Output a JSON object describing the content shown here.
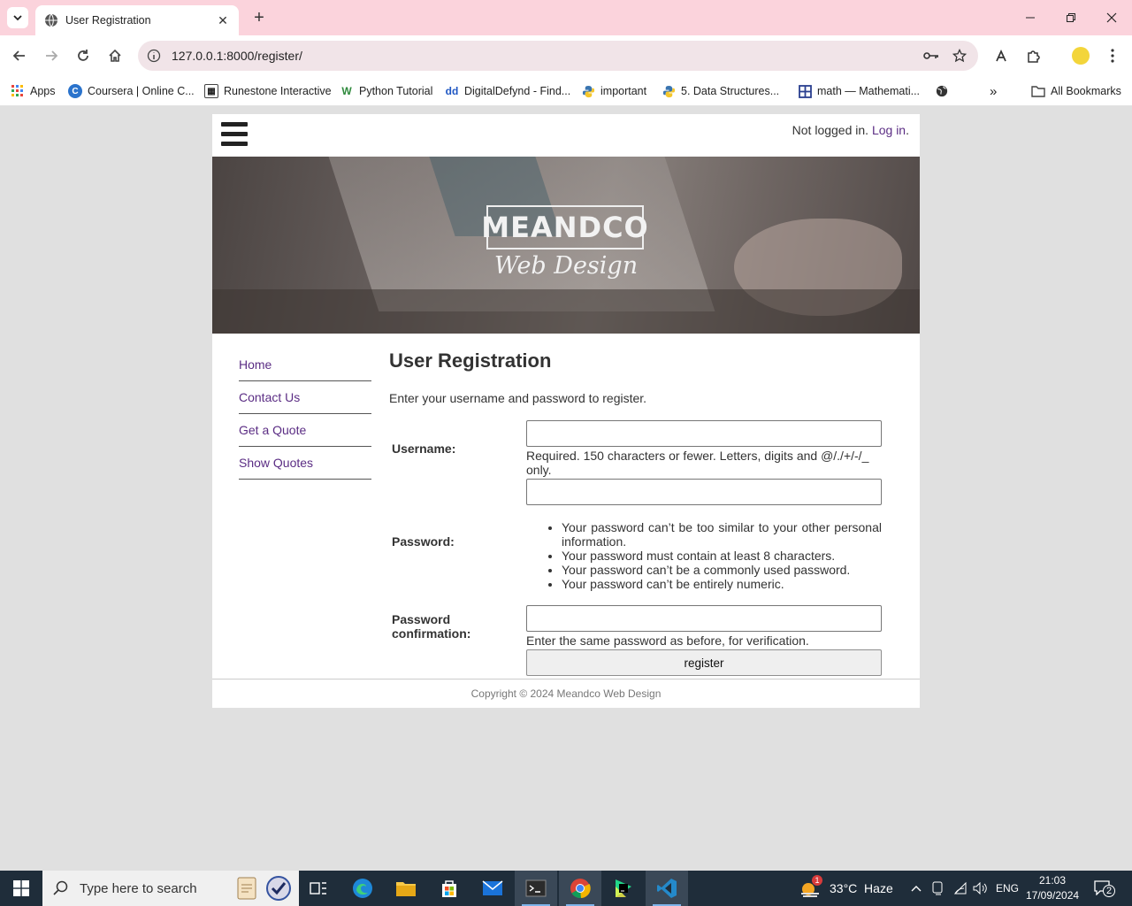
{
  "browser": {
    "tab_title": "User Registration",
    "url": "127.0.0.1:8000/register/",
    "bookmarks": [
      {
        "label": "Apps"
      },
      {
        "label": "Coursera | Online C..."
      },
      {
        "label": "Runestone Interactive"
      },
      {
        "label": "Python Tutorial"
      },
      {
        "label": "DigitalDefynd - Find..."
      },
      {
        "label": "important"
      },
      {
        "label": "5. Data Structures..."
      },
      {
        "label": "math — Mathemati..."
      }
    ],
    "all_bookmarks": "All Bookmarks",
    "overflow": "»"
  },
  "header": {
    "status_text": "Not logged in.",
    "login_link": "Log in",
    "period": "."
  },
  "banner": {
    "logo": "MEANDCO",
    "subtitle": "Web Design"
  },
  "sidenav": [
    {
      "label": "Home"
    },
    {
      "label": "Contact Us"
    },
    {
      "label": "Get a Quote"
    },
    {
      "label": "Show Quotes"
    }
  ],
  "form": {
    "title": "User Registration",
    "intro": "Enter your username and password to register.",
    "username_label": "Username:",
    "username_help": "Required. 150 characters or fewer. Letters, digits and @/./+/-/_ only.",
    "password_label": "Password:",
    "password_rules": [
      "Your password can’t be too similar to your other personal information.",
      "Your password must contain at least 8 characters.",
      "Your password can’t be a commonly used password.",
      "Your password can’t be entirely numeric."
    ],
    "confirm_label": "Password confirmation:",
    "confirm_help": "Enter the same password as before, for verification.",
    "submit_label": "register"
  },
  "footer": {
    "copyright": "Copyright © 2024 Meandco Web Design"
  },
  "taskbar": {
    "search_placeholder": "Type here to search",
    "weather": "33°C  Haze",
    "weather_badge": "1",
    "language": "ENG",
    "time": "21:03",
    "date": "17/09/2024",
    "notification_count": "2"
  },
  "colors": {
    "link": "#5b2d84",
    "tab_bar": "#fbd3dc",
    "taskbar": "#1f2d3a"
  }
}
